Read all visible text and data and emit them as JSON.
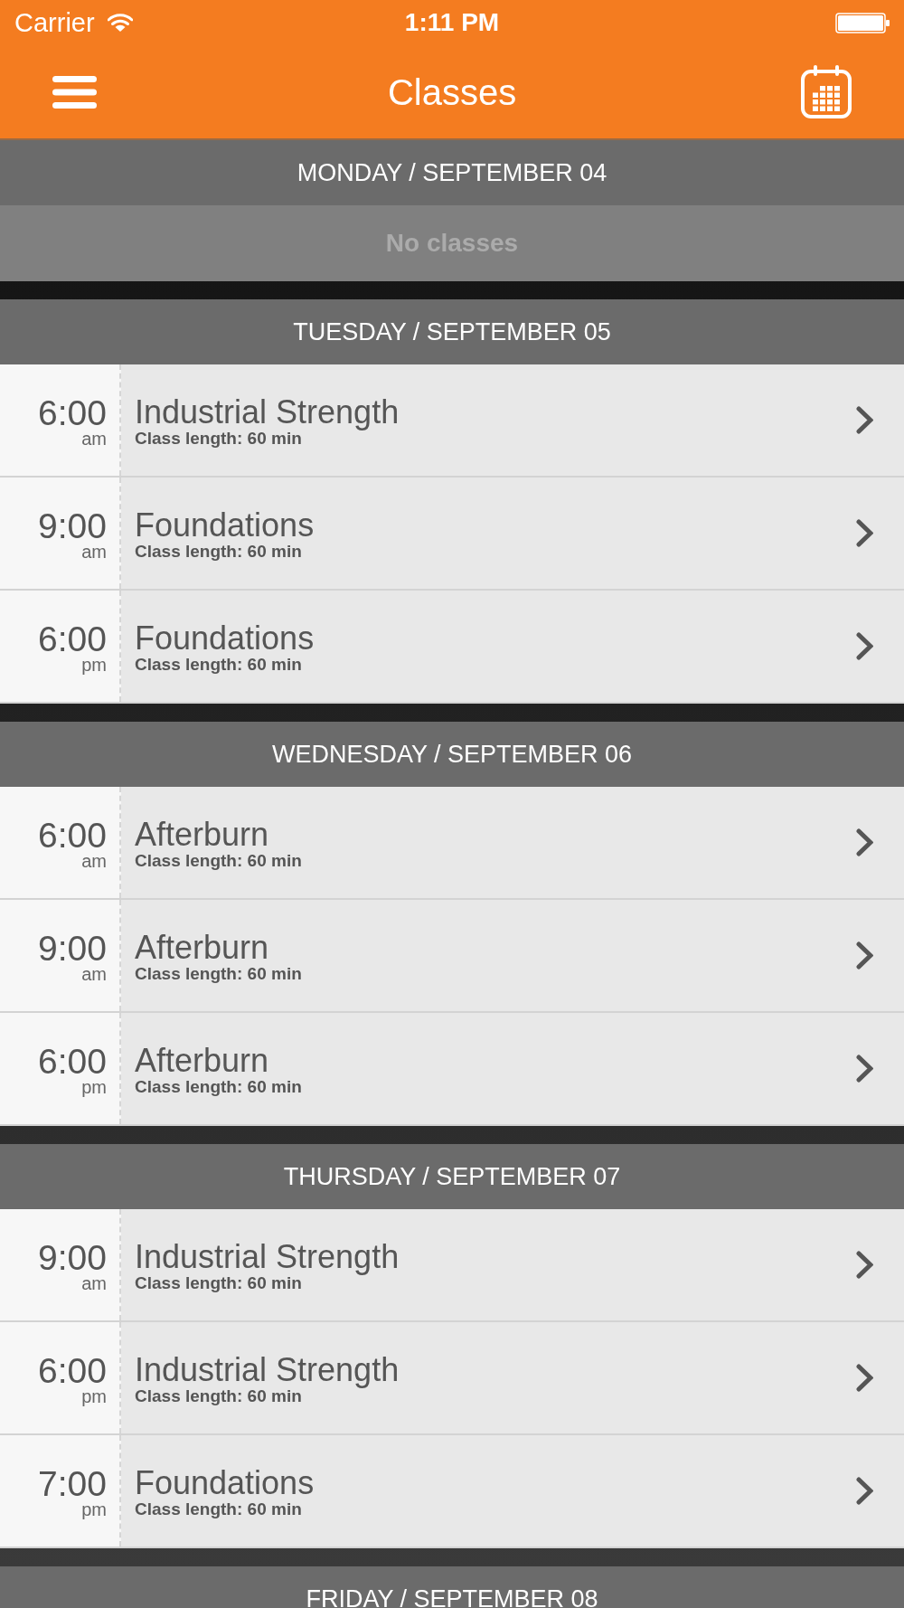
{
  "status_bar": {
    "carrier": "Carrier",
    "time": "1:11 PM"
  },
  "nav_bar": {
    "title": "Classes"
  },
  "days": [
    {
      "heading": "MONDAY / SEPTEMBER 04",
      "empty_message": "No classes"
    },
    {
      "heading": "TUESDAY / SEPTEMBER 05",
      "classes": [
        {
          "time": "6:00",
          "period": "am",
          "name": "Industrial Strength",
          "length": "Class length: 60 min"
        },
        {
          "time": "9:00",
          "period": "am",
          "name": "Foundations",
          "length": "Class length: 60 min"
        },
        {
          "time": "6:00",
          "period": "pm",
          "name": "Foundations",
          "length": "Class length: 60 min"
        }
      ]
    },
    {
      "heading": "WEDNESDAY / SEPTEMBER 06",
      "classes": [
        {
          "time": "6:00",
          "period": "am",
          "name": "Afterburn",
          "length": "Class length: 60 min"
        },
        {
          "time": "9:00",
          "period": "am",
          "name": "Afterburn",
          "length": "Class length: 60 min"
        },
        {
          "time": "6:00",
          "period": "pm",
          "name": "Afterburn",
          "length": "Class length: 60 min"
        }
      ]
    },
    {
      "heading": "THURSDAY / SEPTEMBER 07",
      "classes": [
        {
          "time": "9:00",
          "period": "am",
          "name": "Industrial Strength",
          "length": "Class length: 60 min"
        },
        {
          "time": "6:00",
          "period": "pm",
          "name": "Industrial Strength",
          "length": "Class length: 60 min"
        },
        {
          "time": "7:00",
          "period": "pm",
          "name": "Foundations",
          "length": "Class length: 60 min"
        }
      ]
    },
    {
      "heading": "FRIDAY / SEPTEMBER 08"
    }
  ]
}
